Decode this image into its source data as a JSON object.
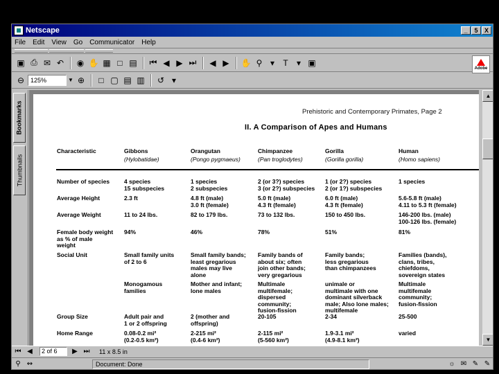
{
  "window": {
    "title": "Netscape"
  },
  "menu": [
    "File",
    "Edit",
    "View",
    "Go",
    "Communicator",
    "Help"
  ],
  "toolbar": {
    "zoom": "125%",
    "adobe_logo_text": "Adobe"
  },
  "nav_tabs": {
    "bookmarks": "Bookmarks",
    "thumbnails": "Thumbnails"
  },
  "document": {
    "page_header": "Prehistoric and Contemporary Primates, Page 2",
    "section_title": "II. A Comparison of Apes and Humans",
    "columns": [
      {
        "name": "Characteristic",
        "sub": ""
      },
      {
        "name": "Gibbons",
        "sub": "(Hylobatidae)"
      },
      {
        "name": "Orangutan",
        "sub": "(Pongo pygmaeus)"
      },
      {
        "name": "Chimpanzee",
        "sub": "(Pan troglodytes)"
      },
      {
        "name": "Gorilla",
        "sub": "(Gorilla gorilla)"
      },
      {
        "name": "Human",
        "sub": "(Homo sapiens)"
      }
    ],
    "rows": [
      {
        "label": "Number of species",
        "cells": [
          "4 species\n15 subspecies",
          "1 species\n2 subspecies",
          "2 (or 3?) species\n3 (or 2?) subspecies",
          "1 (or 2?) species\n2 (or 1?) subspecies",
          "1 species"
        ]
      },
      {
        "label": "Average Height",
        "cells": [
          "2.3 ft",
          "4.8 ft (male)\n3.0 ft (female)",
          "5.0 ft (male)\n4.3 ft (female)",
          "6.0 ft (male)\n4.3 ft (female)",
          "5.6-5.8 ft (male)\n4.11 to 5.3 ft (female)"
        ]
      },
      {
        "label": "Average Weight",
        "cells": [
          "11 to 24 lbs.",
          "82 to 179 lbs.",
          "73 to 132 lbs.",
          "150 to 450 lbs.",
          "146-200 lbs. (male)\n100-126 lbs. (female)"
        ]
      },
      {
        "label": "Female body weight\nas % of male\nweight",
        "cells": [
          "94%",
          "46%",
          "78%",
          "51%",
          "81%"
        ]
      },
      {
        "label": "Social Unit",
        "cells": [
          "Small family units\nof 2 to 6",
          "Small family bands;\nleast gregarious\nmales may live\nalone",
          "Family bands of\nabout six; often\njoin other bands;\nvery gregarious",
          "Family bands;\nless gregarious\nthan chimpanzees",
          "Families (bands),\nclans, tribes,\nchiefdoms,\nsovereign states"
        ]
      },
      {
        "label": "",
        "cells": [
          "Monogamous\nfamilies",
          "Mother and infant;\nlone males",
          "Multimale\nmultifemale;\ndispersed\ncommunity;\nfusion-fission",
          "unimale or\nmultimale with one\ndominant silverback\nmale; Also lone males;\nmultifemale",
          "Multimale\nmultifemale\ncommunity;\nfusion-fission"
        ]
      },
      {
        "label": "Group Size",
        "cells": [
          "Adult pair and\n1 or 2 offspring",
          "2 (mother and\noffspring)",
          "20-105",
          "2-34",
          "25-500"
        ]
      },
      {
        "label": "Home Range",
        "cells": [
          "0.08-0.2 mi²\n(0.2-0.5 km²)",
          "2-215 mi²\n(0.4-6 km²)",
          "2-115 mi²\n(5-560 km²)",
          "1.9-3.1 mi²\n(4.9-8.1 km²)",
          "varied"
        ]
      }
    ]
  },
  "nav": {
    "page_field": "2 of 6",
    "size_field": "11 x 8.5 in"
  },
  "status": {
    "text": "Document: Done"
  }
}
